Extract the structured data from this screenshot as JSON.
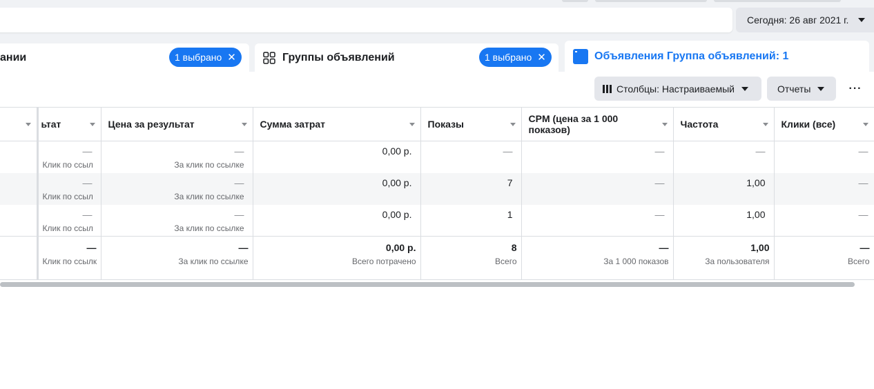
{
  "date_range": {
    "label": "Сегодня: 26 авг 2021 г."
  },
  "tabs": [
    {
      "label": "ании",
      "badge": "1 выбрано"
    },
    {
      "label": "Группы объявлений",
      "badge": "1 выбрано"
    },
    {
      "label": "Объявления Группа объявлений: 1"
    }
  ],
  "toolbar": {
    "columns_label": "Столбцы: Настраиваемый",
    "reports_label": "Отчеты",
    "more_label": "···"
  },
  "table": {
    "columns": [
      "",
      "ьтат",
      "Цена за результат",
      "Сумма затрат",
      "Показы",
      "CPM (цена за 1 000 показов)",
      "Частота",
      "Клики (все)"
    ],
    "rows": [
      {
        "cells": [
          {
            "v": "",
            "s": ""
          },
          {
            "v": "—",
            "s": "Клик по ссылке"
          },
          {
            "v": "—",
            "s": "За клик по ссылке"
          },
          {
            "v": "0,00 р.",
            "s": ""
          },
          {
            "v": "—",
            "s": ""
          },
          {
            "v": "—",
            "s": ""
          },
          {
            "v": "—",
            "s": ""
          },
          {
            "v": "—",
            "s": ""
          }
        ]
      },
      {
        "cells": [
          {
            "v": "",
            "s": ""
          },
          {
            "v": "—",
            "s": "Клик по ссылке"
          },
          {
            "v": "—",
            "s": "За клик по ссылке"
          },
          {
            "v": "0,00 р.",
            "s": ""
          },
          {
            "v": "7",
            "s": ""
          },
          {
            "v": "—",
            "s": ""
          },
          {
            "v": "1,00",
            "s": ""
          },
          {
            "v": "—",
            "s": ""
          }
        ]
      },
      {
        "cells": [
          {
            "v": "",
            "s": ""
          },
          {
            "v": "—",
            "s": "Клик по ссылке"
          },
          {
            "v": "—",
            "s": "За клик по ссылке"
          },
          {
            "v": "0,00 р.",
            "s": ""
          },
          {
            "v": "1",
            "s": ""
          },
          {
            "v": "—",
            "s": ""
          },
          {
            "v": "1,00",
            "s": ""
          },
          {
            "v": "—",
            "s": ""
          }
        ]
      }
    ],
    "totals": [
      {
        "v": "",
        "s": ""
      },
      {
        "v": "—",
        "s": "Клик по ссылке"
      },
      {
        "v": "—",
        "s": "За клик по ссылке"
      },
      {
        "v": "0,00 р.",
        "s": "Всего потрачено"
      },
      {
        "v": "8",
        "s": "Всего"
      },
      {
        "v": "—",
        "s": "За 1 000 показов"
      },
      {
        "v": "1,00",
        "s": "За пользователя"
      },
      {
        "v": "—",
        "s": "Всего"
      }
    ]
  }
}
